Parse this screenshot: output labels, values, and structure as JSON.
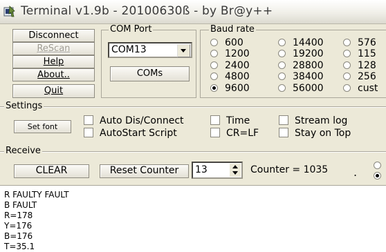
{
  "window": {
    "title": "Terminal v1.9b - 20100630ß - by Br@y++",
    "icon": "terminal-app-icon"
  },
  "buttons": {
    "disconnect": "Disconnect",
    "rescan": "ReScan",
    "help": "Help",
    "about": "About..",
    "quit": "Quit",
    "coms": "COMs",
    "set_font": "Set font",
    "clear": "CLEAR",
    "reset_counter": "Reset Counter"
  },
  "com_port": {
    "label": "COM Port",
    "selected": "COM13"
  },
  "baud_rate": {
    "label": "Baud rate",
    "options": [
      {
        "label": "600",
        "selected": false
      },
      {
        "label": "1200",
        "selected": false
      },
      {
        "label": "2400",
        "selected": false
      },
      {
        "label": "4800",
        "selected": false
      },
      {
        "label": "9600",
        "selected": true
      },
      {
        "label": "14400",
        "selected": false
      },
      {
        "label": "19200",
        "selected": false
      },
      {
        "label": "28800",
        "selected": false
      },
      {
        "label": "38400",
        "selected": false
      },
      {
        "label": "56000",
        "selected": false
      },
      {
        "label": "576",
        "selected": false
      },
      {
        "label": "115",
        "selected": false
      },
      {
        "label": "128",
        "selected": false
      },
      {
        "label": "256",
        "selected": false
      },
      {
        "label": "cust",
        "selected": false
      }
    ]
  },
  "settings": {
    "label": "Settings",
    "checks": [
      {
        "label": "Auto Dis/Connect",
        "checked": false
      },
      {
        "label": "AutoStart Script",
        "checked": false
      },
      {
        "label": "Time",
        "checked": false
      },
      {
        "label": "CR=LF",
        "checked": false
      },
      {
        "label": "Stream log",
        "checked": false
      },
      {
        "label": "Stay on Top",
        "checked": false
      }
    ]
  },
  "receive": {
    "label": "Receive",
    "spin_value": "13",
    "counter_text": "Counter = 1035",
    "dot": "."
  },
  "output": {
    "lines": [
      "R FAULTY FAULT",
      "B FAULT",
      "R=178",
      "Y=176",
      "B=176",
      "T=35.1"
    ]
  }
}
